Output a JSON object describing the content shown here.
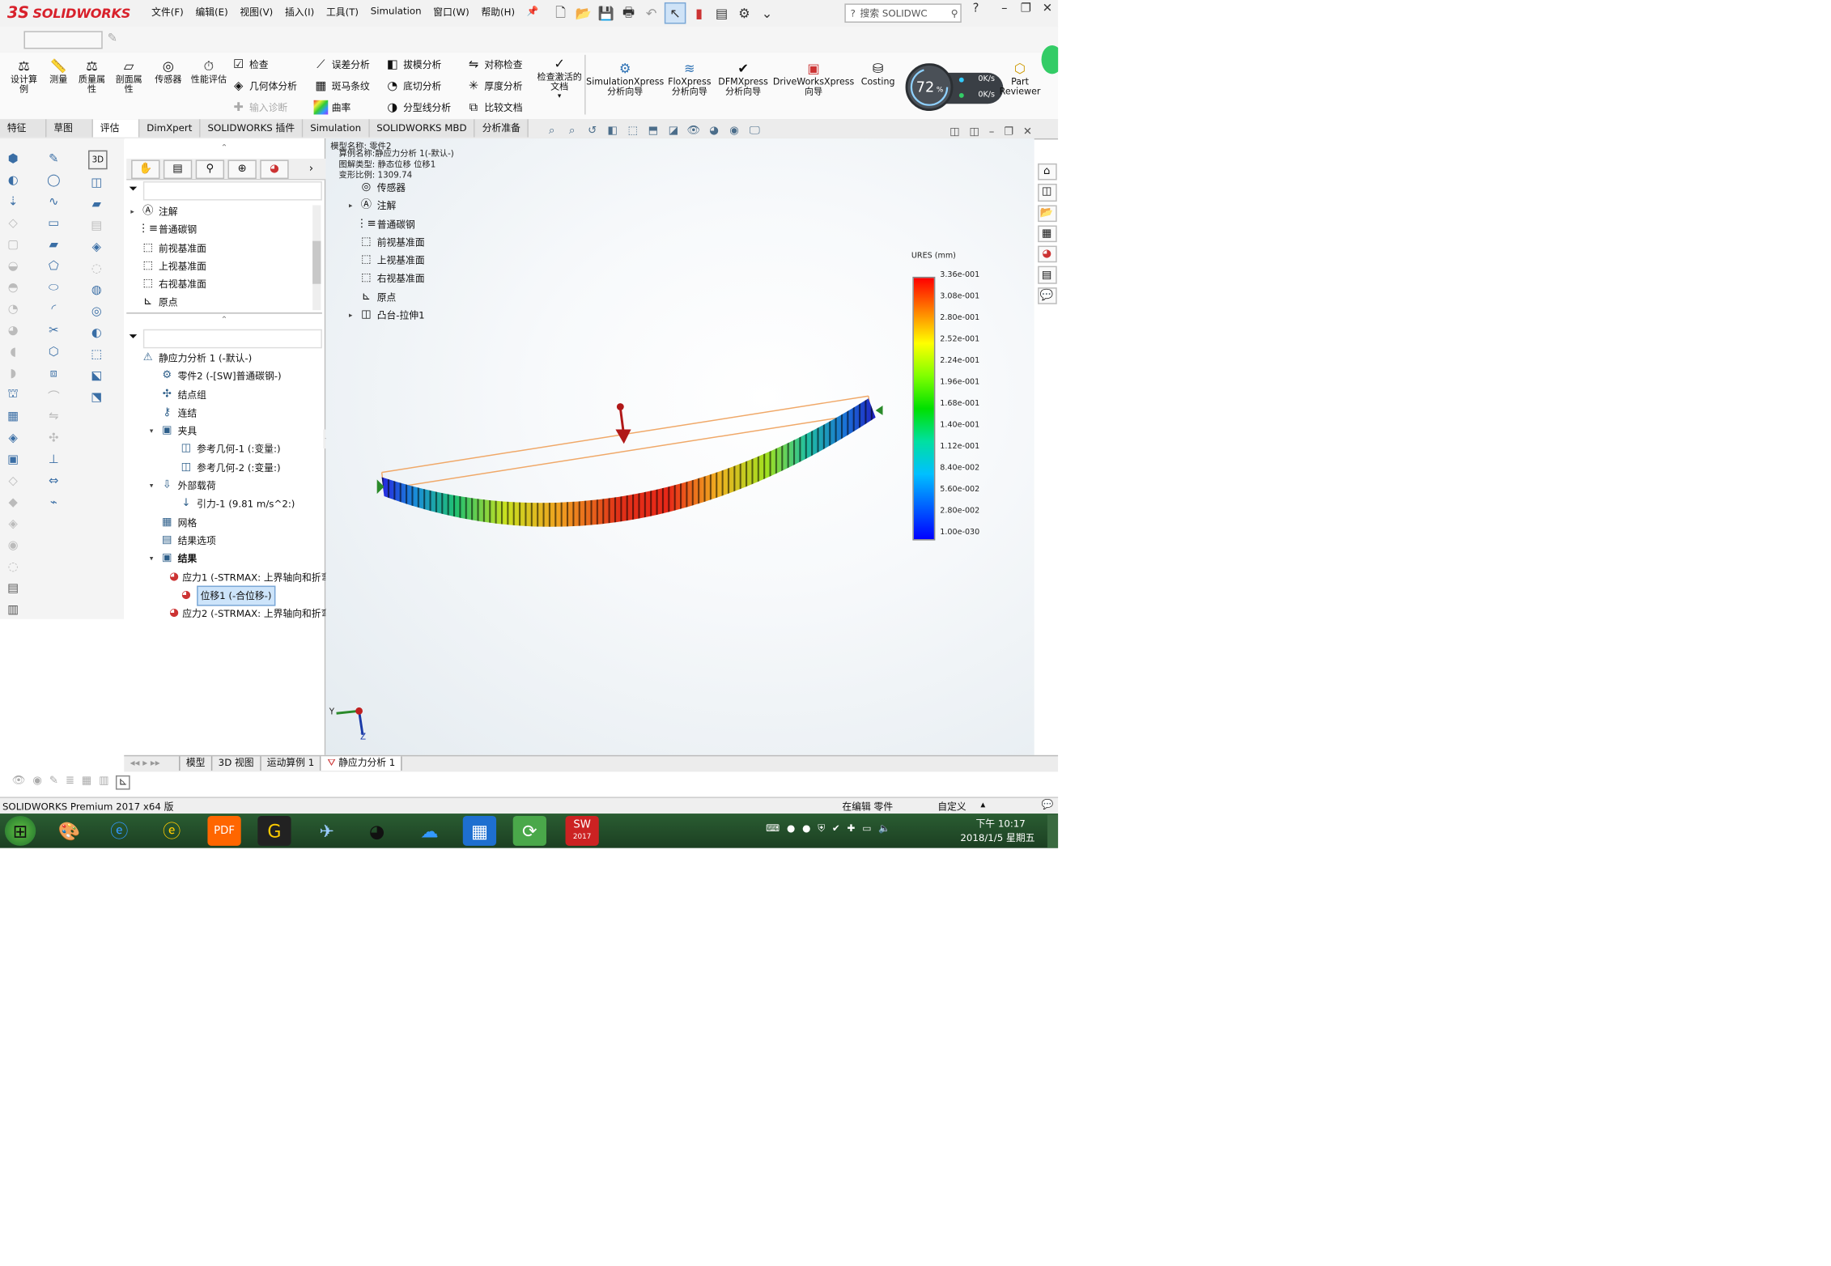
{
  "app": {
    "logo_ds": "3S",
    "logo_name": "SOLIDWORKS",
    "menus": [
      "文件(F)",
      "编辑(E)",
      "视图(V)",
      "插入(I)",
      "工具(T)",
      "Simulation",
      "窗口(W)",
      "帮助(H)"
    ],
    "search_placeholder": "搜索 SOLIDWC",
    "help": "?"
  },
  "ribbon": {
    "big_buttons": [
      {
        "label": "设计算例",
        "icon": "design-study-icon"
      },
      {
        "label": "测量",
        "icon": "measure-icon"
      },
      {
        "label": "质量属性",
        "icon": "mass-properties-icon"
      },
      {
        "label": "剖面属性",
        "icon": "section-properties-icon"
      },
      {
        "label": "传感器",
        "icon": "sensor-icon"
      },
      {
        "label": "性能评估",
        "icon": "performance-evaluation-icon"
      }
    ],
    "small_col1": [
      {
        "label": "检查",
        "disabled": false
      },
      {
        "label": "几何体分析",
        "disabled": false
      },
      {
        "label": "输入诊断",
        "disabled": true
      }
    ],
    "small_col2": [
      "误差分析",
      "斑马条纹",
      "曲率"
    ],
    "small_col3": [
      "拔模分析",
      "底切分析",
      "分型线分析"
    ],
    "small_col4": [
      "对称检查",
      "厚度分析",
      "比较文档"
    ],
    "check_active": "检查激活的文档",
    "addins": [
      "SimulationXpress 分析向导",
      "FloXpress 分析向导",
      "DFMXpress 分析向导",
      "DriveWorksXpress 向导",
      "Costing"
    ],
    "part_reviewer": "Part Reviewer",
    "gauge": {
      "percent": "72",
      "unit": "%",
      "up": "0K/s",
      "down": "0K/s"
    }
  },
  "tabs": [
    "特征",
    "草图",
    "评估",
    "DimXpert",
    "SOLIDWORKS 插件",
    "Simulation",
    "SOLIDWORKS MBD",
    "分析准备"
  ],
  "tabs_active": "评估",
  "feature_tree": {
    "items": [
      {
        "label": "注解",
        "expand": "▸"
      },
      {
        "label": "普通碳钢",
        "expand": ""
      },
      {
        "label": "前视基准面",
        "expand": ""
      },
      {
        "label": "上视基准面",
        "expand": ""
      },
      {
        "label": "右视基准面",
        "expand": ""
      },
      {
        "label": "原点",
        "expand": ""
      }
    ]
  },
  "sim_tree": {
    "items": [
      {
        "label": "静应力分析 1 (-默认-)",
        "level": 0,
        "expand": ""
      },
      {
        "label": "零件2 (-[SW]普通碳钢-)",
        "level": 1,
        "expand": ""
      },
      {
        "label": "结点组",
        "level": 1,
        "expand": ""
      },
      {
        "label": "连结",
        "level": 1,
        "expand": ""
      },
      {
        "label": "夹具",
        "level": 1,
        "expand": "▾"
      },
      {
        "label": "参考几何-1 (:变量:)",
        "level": 2,
        "expand": ""
      },
      {
        "label": "参考几何-2 (:变量:)",
        "level": 2,
        "expand": ""
      },
      {
        "label": "外部载荷",
        "level": 1,
        "expand": "▾"
      },
      {
        "label": "引力-1 (9.81 m/s^2:)",
        "level": 2,
        "expand": ""
      },
      {
        "label": "网格",
        "level": 1,
        "expand": ""
      },
      {
        "label": "结果选项",
        "level": 1,
        "expand": ""
      },
      {
        "label": "结果",
        "level": 1,
        "expand": "▾"
      },
      {
        "label": "应力1 (-STRMAX: 上界轴向和折弯",
        "level": 2,
        "expand": ""
      },
      {
        "label": "位移1 (-合位移-)",
        "level": 2,
        "expand": "",
        "selected": true
      },
      {
        "label": "应力2 (-STRMAX: 上界轴向和折弯",
        "level": 2,
        "expand": ""
      }
    ]
  },
  "viewport_tree": {
    "header": [
      "模型名称: 零件2",
      "算例名称:静应力分析 1(-默认-)",
      "图解类型: 静态位移 位移1",
      "变形比例: 1309.74"
    ],
    "items": [
      {
        "label": "传感器",
        "expand": ""
      },
      {
        "label": "注解",
        "expand": "▸"
      },
      {
        "label": "普通碳钢",
        "expand": ""
      },
      {
        "label": "前视基准面",
        "expand": ""
      },
      {
        "label": "上视基准面",
        "expand": ""
      },
      {
        "label": "右视基准面",
        "expand": ""
      },
      {
        "label": "原点",
        "expand": ""
      },
      {
        "label": "凸台-拉伸1",
        "expand": "▸"
      }
    ]
  },
  "legend": {
    "title": "URES (mm)",
    "values": [
      "3.36e-001",
      "3.08e-001",
      "2.80e-001",
      "2.52e-001",
      "2.24e-001",
      "1.96e-001",
      "1.68e-001",
      "1.40e-001",
      "1.12e-001",
      "8.40e-002",
      "5.60e-002",
      "2.80e-002",
      "1.00e-030"
    ]
  },
  "axis": {
    "y": "Y",
    "z": "Z"
  },
  "bottom_tabs": [
    "模型",
    "3D 视图",
    "运动算例 1",
    "静应力分析 1"
  ],
  "bottom_tabs_active": "静应力分析 1",
  "status": {
    "product": "SOLIDWORKS Premium 2017 x64 版",
    "editing": "在编辑 零件",
    "units": "自定义"
  },
  "taskbar": {
    "time": "下午 10:17",
    "date": "2018/1/5 星期五",
    "sw_badge": "2017"
  },
  "colors": {
    "accent": "#d8212b",
    "taskbar": "#234a29",
    "selection": "#cde4fa"
  }
}
